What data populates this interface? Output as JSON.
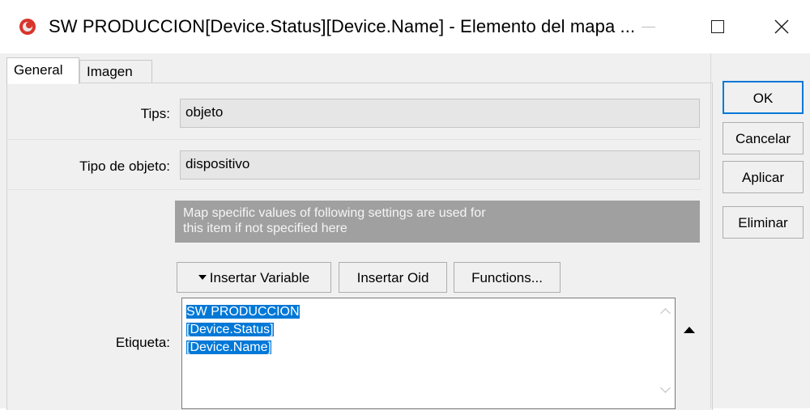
{
  "window": {
    "title": "SW PRODUCCION[Device.Status][Device.Name] - Elemento del mapa ...",
    "icon": "app-icon",
    "controls": {
      "minimize_icon": "minimize-icon",
      "maximize_glyph": "☐",
      "close_glyph": "✕"
    }
  },
  "tabs": [
    {
      "label": "General",
      "active": true
    },
    {
      "label": "Imagen",
      "active": false
    }
  ],
  "form": {
    "tips_label": "Tips:",
    "tips_value": "objeto",
    "type_label": "Tipo de objeto:",
    "type_value": "dispositivo",
    "info_line1": "Map specific values of following settings are used for",
    "info_line2": "this item if not specified here",
    "insert_variable": "Insertar Variable",
    "insert_oid": "Insertar Oid",
    "functions": "Functions...",
    "label_label": "Etiqueta:",
    "label_lines": [
      "SW PRODUCCION",
      "[Device.Status]",
      "[Device.Name]"
    ]
  },
  "side_buttons": {
    "ok": "OK",
    "cancel": "Cancelar",
    "apply": "Aplicar",
    "delete": "Eliminar"
  },
  "colors": {
    "selection": "#0078d7",
    "info_box": "#a0a0a0",
    "app_icon": "#d9342b"
  }
}
